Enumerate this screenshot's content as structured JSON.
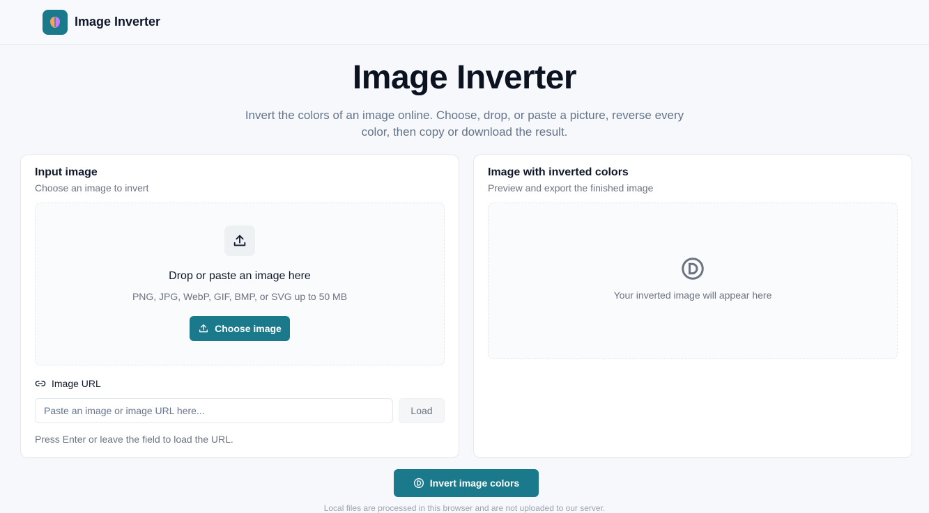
{
  "header": {
    "brand": "Image Inverter",
    "logo_icon": "brain-icon"
  },
  "hero": {
    "title": "Image Inverter",
    "subtitle": "Invert the colors of an image online. Choose, drop, or paste a picture, reverse every color, then copy or download the result."
  },
  "input_card": {
    "title": "Input image",
    "subtitle": "Choose an image to invert",
    "drop_title": "Drop or paste an image here",
    "drop_note": "PNG, JPG, WebP, GIF, BMP, or SVG up to 50 MB",
    "choose_label": "Choose image",
    "url_label": "Image URL",
    "url_placeholder": "Paste an image or image URL here...",
    "load_label": "Load",
    "hint": "Press Enter or leave the field to load the URL."
  },
  "output_card": {
    "title": "Image with inverted colors",
    "subtitle": "Preview and export the finished image",
    "placeholder": "Your inverted image will appear here"
  },
  "actions": {
    "invert_label": "Invert image colors"
  },
  "footer": {
    "note": "Local files are processed in this browser and are not uploaded to our server."
  },
  "colors": {
    "accent": "#1a7a8c",
    "background": "#f6f8fb"
  }
}
